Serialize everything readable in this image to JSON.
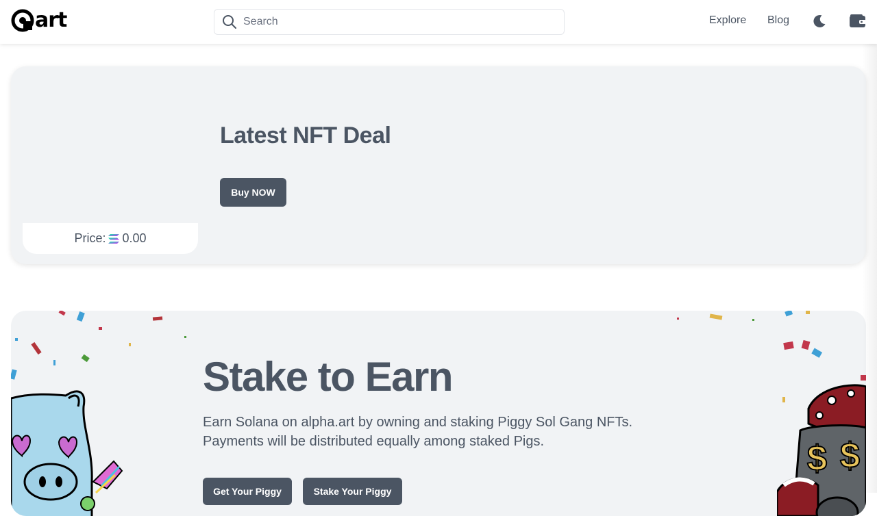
{
  "header": {
    "logo_text": "art",
    "search_placeholder": "Search",
    "nav": {
      "explore": "Explore",
      "blog": "Blog"
    },
    "icons": [
      "search-icon",
      "moon-icon",
      "wallet-icon"
    ]
  },
  "deal": {
    "title": "Latest NFT Deal",
    "buy_label": "Buy NOW",
    "price_label": "Price:",
    "price_value": "0.00",
    "currency_icon": "solana-icon"
  },
  "stake": {
    "title": "Stake to Earn",
    "desc_line1": "Earn Solana on alpha.art by owning and staking Piggy Sol Gang NFTs.",
    "desc_line2": "Payments will be distributed equally among staked Pigs.",
    "get_label": "Get Your Piggy",
    "stake_label": "Stake Your Piggy"
  },
  "colors": {
    "text": "#4b5563",
    "card_bg": "#f1f3f5",
    "button_bg": "#4b5563",
    "pig_left": "#a9d8ec",
    "pig_right": "#5f6468"
  }
}
